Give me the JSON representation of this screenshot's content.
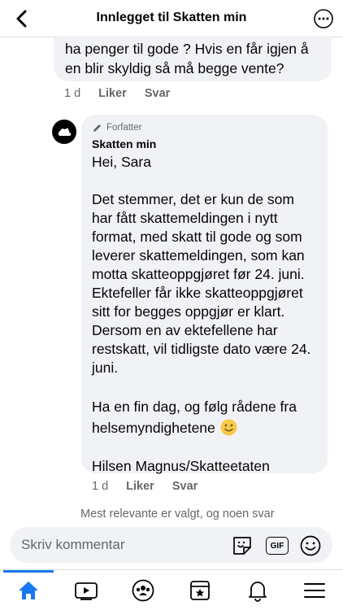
{
  "header": {
    "title": "Innlegget til Skatten min",
    "back_icon": "chevron-left-icon",
    "more_icon": "ellipsis-icon"
  },
  "previous_comment": {
    "text_lines": [
      "ha penger til gode ? Hvis en får igjen å",
      "en blir skyldig så må begge vente?"
    ],
    "time": "1 d",
    "like_label": "Liker",
    "reply_label": "Svar"
  },
  "reply_comment": {
    "badge": "Forfatter",
    "author": "Skatten min",
    "greeting": "Hei, Sara",
    "paragraph1": "Det stemmer, det er kun de som har fått skattemeldingen i nytt format, med skatt til gode og som leverer skattemeldingen, som kan motta skatteoppgjøret før 24. juni. Ektefeller får ikke skatteoppgjøret sitt for begges oppgjør er klart. Dersom en av ektefellene har restskatt, vil tidligste dato være 24. juni.",
    "paragraph2": "Ha en fin dag, og følg rådene fra helsemyndighetene",
    "signature": "Hilsen Magnus/Skatteetaten",
    "time": "1 d",
    "like_label": "Liker",
    "reply_label": "Svar"
  },
  "sort_note": "Mest relevante er valgt, og noen svar",
  "composer": {
    "placeholder": "Skriv kommentar",
    "gif_label": "GIF"
  },
  "tabs": [
    {
      "name": "home-icon",
      "active": true
    },
    {
      "name": "video-icon",
      "active": false
    },
    {
      "name": "groups-icon",
      "active": false
    },
    {
      "name": "pages-icon",
      "active": false
    },
    {
      "name": "bell-icon",
      "active": false
    },
    {
      "name": "menu-icon",
      "active": false
    }
  ],
  "colors": {
    "accent": "#1877f2",
    "bubble": "#f0f2f5",
    "secondary_text": "#65676b"
  }
}
